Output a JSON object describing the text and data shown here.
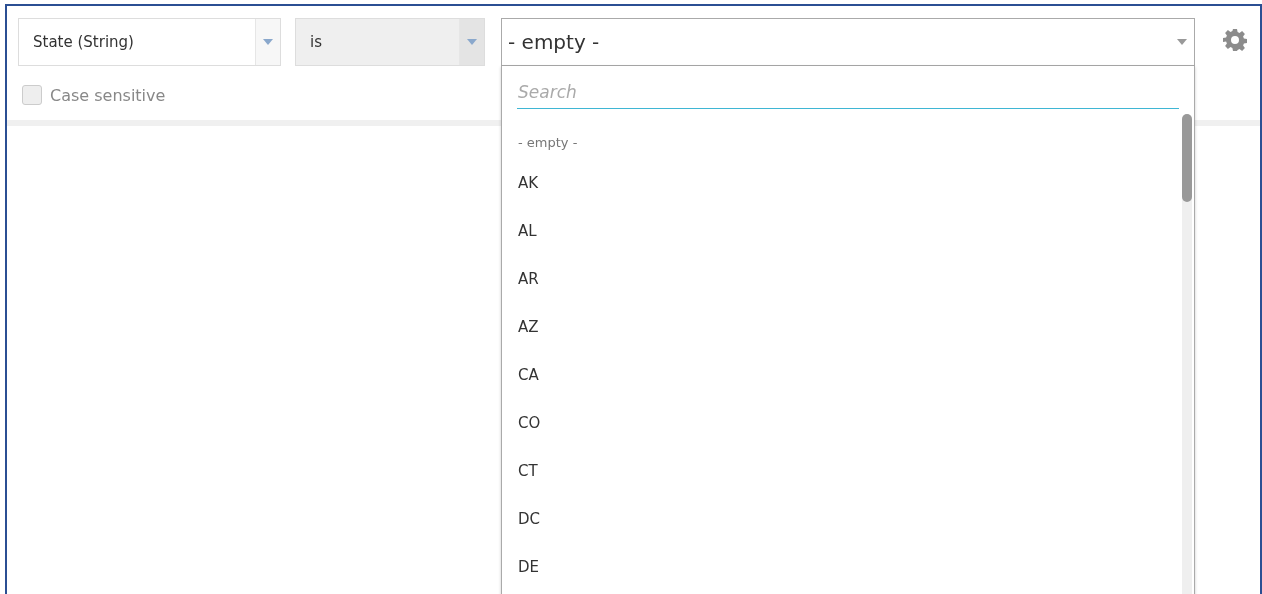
{
  "field_select": {
    "value": "State (String)"
  },
  "operator_select": {
    "value": "is",
    "disabled": true
  },
  "value_select": {
    "value": "- empty -",
    "expanded": true
  },
  "case_sensitive": {
    "label": "Case sensitive",
    "checked": false,
    "disabled": true
  },
  "dropdown": {
    "search": {
      "placeholder": "Search"
    },
    "options": [
      {
        "label": "- empty -",
        "kind": "empty"
      },
      {
        "label": "AK",
        "kind": "value"
      },
      {
        "label": "AL",
        "kind": "value"
      },
      {
        "label": "AR",
        "kind": "value"
      },
      {
        "label": "AZ",
        "kind": "value"
      },
      {
        "label": "CA",
        "kind": "value"
      },
      {
        "label": "CO",
        "kind": "value"
      },
      {
        "label": "CT",
        "kind": "value"
      },
      {
        "label": "DC",
        "kind": "value"
      },
      {
        "label": "DE",
        "kind": "value"
      }
    ]
  }
}
